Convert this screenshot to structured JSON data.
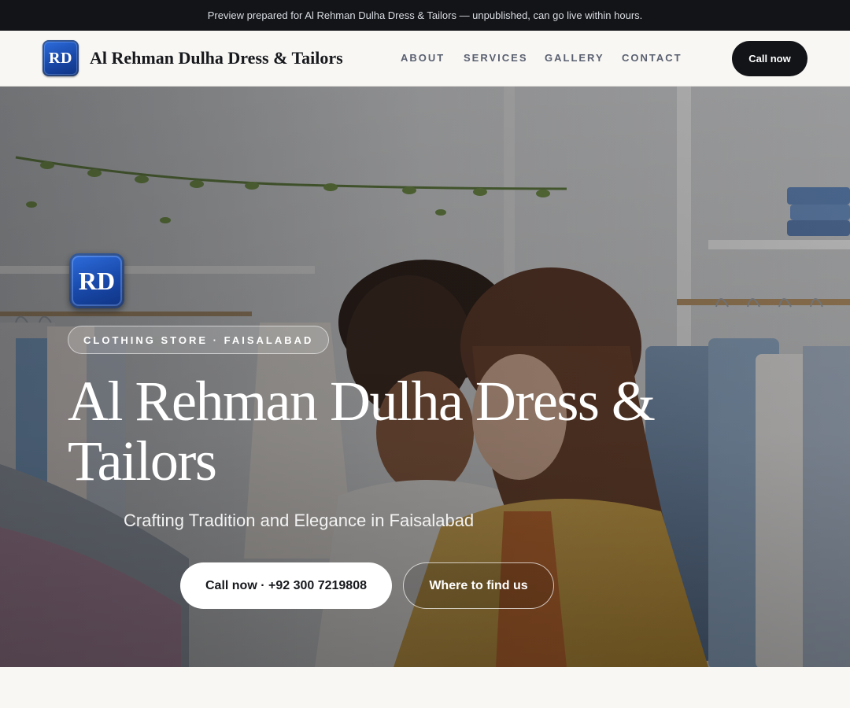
{
  "preview_banner": "Preview prepared for Al Rehman Dulha Dress & Tailors — unpublished, can go live within hours.",
  "header": {
    "logo_text": "RD",
    "brand_name": "Al Rehman Dulha Dress & Tailors",
    "nav": [
      "ABOUT",
      "SERVICES",
      "GALLERY",
      "CONTACT"
    ],
    "cta_label": "Call now"
  },
  "hero": {
    "logo_text": "RD",
    "badge": "CLOTHING STORE · FAISALABAD",
    "title": "Al Rehman Dulha Dress & Tailors",
    "subtitle": "Crafting Tradition and Elegance in Faisalabad",
    "primary_button": "Call now · +92 300 7219808",
    "secondary_button": "Where to find us"
  },
  "colors": {
    "dark": "#121418",
    "logo_blue": "#1848a8",
    "page_bg": "#f8f7f4",
    "jacket_yellow": "#d7a540"
  },
  "icons": [
    "rd-logo-icon"
  ]
}
